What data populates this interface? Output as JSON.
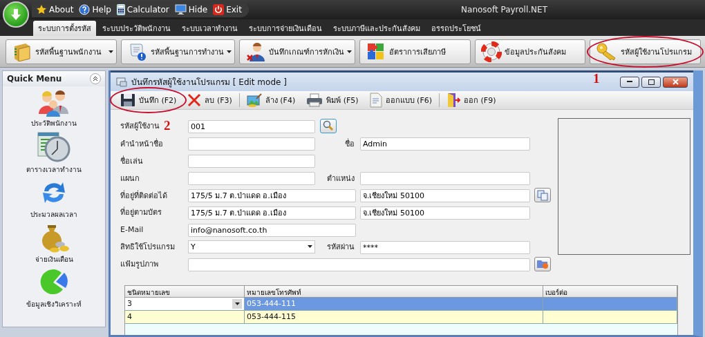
{
  "app": {
    "title": "Nanosoft Payroll.NET",
    "quick_access": [
      {
        "label": "About"
      },
      {
        "label": "Help"
      },
      {
        "label": "Calculator"
      },
      {
        "label": "Hide"
      },
      {
        "label": "Exit"
      }
    ]
  },
  "menu_tabs": [
    {
      "label": "ระบบการตั้งรหัส",
      "selected": true
    },
    {
      "label": "ระบบประวัติพนักงาน",
      "selected": false
    },
    {
      "label": "ระบบเวลาทำงาน",
      "selected": false
    },
    {
      "label": "ระบบการจ่ายเงินเดือน",
      "selected": false
    },
    {
      "label": "ระบบภาษีและประกันสังคม",
      "selected": false
    },
    {
      "label": "อรรถประโยชน์",
      "selected": false
    }
  ],
  "ribbon": [
    {
      "label": "รหัสพื้นฐานพนักงาน",
      "dropdown": true,
      "circled": false
    },
    {
      "label": "รหัสพื้นฐานการทำงาน",
      "dropdown": true,
      "circled": false
    },
    {
      "label": "บันทึกเกณฑ์การหักเงิน",
      "dropdown": true,
      "circled": false
    },
    {
      "label": "อัตราการเสียภาษี",
      "dropdown": false,
      "circled": false
    },
    {
      "label": "ข้อมูลประกันสังคม",
      "dropdown": false,
      "circled": false
    },
    {
      "label": "รหัสผู้ใช้งานโปรแกรม",
      "dropdown": false,
      "circled": true,
      "marker": "1"
    }
  ],
  "quick_menu": {
    "title": "Quick Menu",
    "items": [
      {
        "label": "ประวัติพนักงาน"
      },
      {
        "label": "ตารางเวลาทำงาน"
      },
      {
        "label": "ประมวลผลเวลา"
      },
      {
        "label": "จ่ายเงินเดือน"
      },
      {
        "label": "ข้อมูลเชิงวิเคราะห์"
      }
    ]
  },
  "window": {
    "title": "บันทึกรหัสผู้ใช้งานโปรแกรม [ Edit mode ]"
  },
  "toolbar": [
    {
      "label": "บันทึก (F2)",
      "circled": true
    },
    {
      "label": "ลบ (F3)",
      "circled": false
    },
    {
      "label": "ล้าง (F4)",
      "circled": false
    },
    {
      "label": "พิมพ์ (F5)",
      "circled": false
    },
    {
      "label": "ออกแบบ (F6)",
      "circled": false
    },
    {
      "label": "ออก (F9)",
      "circled": false
    }
  ],
  "form": {
    "rows": [
      {
        "kind": "short",
        "label": "รหัสผู้ใช้งาน",
        "marker": "2",
        "value": "001",
        "button": {
          "kind": "search"
        }
      },
      {
        "kind": "short",
        "label": "คำนำหน้าชื่อ",
        "label_2": "ชื่อ",
        "value_2": "Admin"
      },
      {
        "kind": "short",
        "label": "ชื่อเล่น"
      },
      {
        "kind": "short",
        "label": "แผนก",
        "label_2": "ตำแหน่ง"
      },
      {
        "kind": "address",
        "label": "ที่อยู่ที่ติดต่อได้",
        "value": "175/5 ม.7 ต.ป่าแดด อ.เมือง",
        "value_2": "จ.เชียงใหม่ 50100",
        "button": {
          "kind": "copy"
        }
      },
      {
        "kind": "address",
        "label": "ที่อยู่ตามบัตร",
        "value": "175/5 ม.7 ต.ป่าแดด อ.เมือง",
        "value_2": "จ.เชียงใหม่ 50100"
      },
      {
        "kind": "address",
        "label": "E-Mail",
        "value": "info@nanosoft.co.th"
      },
      {
        "kind": "select",
        "label": "สิทธิใช้โปรแกรม",
        "value": "Y",
        "label_2": "รหัสผ่าน",
        "value_2": "****"
      },
      {
        "kind": "wide",
        "label": "แฟ้มรูปภาพ",
        "button": {
          "kind": "folder"
        }
      }
    ]
  },
  "phones": {
    "columns": [
      "ชนิดหมายเลข",
      "หมายเลขโทรศัพท์",
      "เบอร์ต่อ"
    ],
    "rows": [
      {
        "cells": [
          "3",
          "053-444-111"
        ],
        "selected": true
      },
      {
        "cells": [
          "4",
          "053-444-115"
        ],
        "selected": false
      }
    ]
  }
}
